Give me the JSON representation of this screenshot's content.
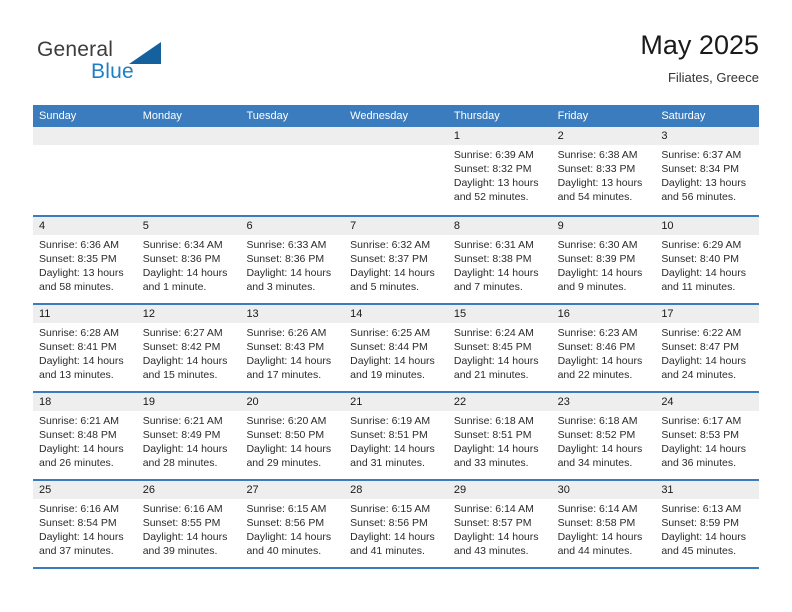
{
  "brand": {
    "name_top": "General",
    "name_bottom": "Blue",
    "triangle_color": "#15619e",
    "blue_color": "#1f7fc4"
  },
  "header": {
    "title": "May 2025",
    "subtitle": "Filiates, Greece"
  },
  "theme": {
    "header_blue": "#3a7cbe",
    "daynum_band": "#eeeeee",
    "text": "#2b2b2b"
  },
  "weekdays": [
    "Sunday",
    "Monday",
    "Tuesday",
    "Wednesday",
    "Thursday",
    "Friday",
    "Saturday"
  ],
  "weeks": [
    [
      {
        "empty": true
      },
      {
        "empty": true
      },
      {
        "empty": true
      },
      {
        "empty": true
      },
      {
        "day": "1",
        "sunrise": "Sunrise: 6:39 AM",
        "sunset": "Sunset: 8:32 PM",
        "daylight": "Daylight: 13 hours and 52 minutes."
      },
      {
        "day": "2",
        "sunrise": "Sunrise: 6:38 AM",
        "sunset": "Sunset: 8:33 PM",
        "daylight": "Daylight: 13 hours and 54 minutes."
      },
      {
        "day": "3",
        "sunrise": "Sunrise: 6:37 AM",
        "sunset": "Sunset: 8:34 PM",
        "daylight": "Daylight: 13 hours and 56 minutes."
      }
    ],
    [
      {
        "day": "4",
        "sunrise": "Sunrise: 6:36 AM",
        "sunset": "Sunset: 8:35 PM",
        "daylight": "Daylight: 13 hours and 58 minutes."
      },
      {
        "day": "5",
        "sunrise": "Sunrise: 6:34 AM",
        "sunset": "Sunset: 8:36 PM",
        "daylight": "Daylight: 14 hours and 1 minute."
      },
      {
        "day": "6",
        "sunrise": "Sunrise: 6:33 AM",
        "sunset": "Sunset: 8:36 PM",
        "daylight": "Daylight: 14 hours and 3 minutes."
      },
      {
        "day": "7",
        "sunrise": "Sunrise: 6:32 AM",
        "sunset": "Sunset: 8:37 PM",
        "daylight": "Daylight: 14 hours and 5 minutes."
      },
      {
        "day": "8",
        "sunrise": "Sunrise: 6:31 AM",
        "sunset": "Sunset: 8:38 PM",
        "daylight": "Daylight: 14 hours and 7 minutes."
      },
      {
        "day": "9",
        "sunrise": "Sunrise: 6:30 AM",
        "sunset": "Sunset: 8:39 PM",
        "daylight": "Daylight: 14 hours and 9 minutes."
      },
      {
        "day": "10",
        "sunrise": "Sunrise: 6:29 AM",
        "sunset": "Sunset: 8:40 PM",
        "daylight": "Daylight: 14 hours and 11 minutes."
      }
    ],
    [
      {
        "day": "11",
        "sunrise": "Sunrise: 6:28 AM",
        "sunset": "Sunset: 8:41 PM",
        "daylight": "Daylight: 14 hours and 13 minutes."
      },
      {
        "day": "12",
        "sunrise": "Sunrise: 6:27 AM",
        "sunset": "Sunset: 8:42 PM",
        "daylight": "Daylight: 14 hours and 15 minutes."
      },
      {
        "day": "13",
        "sunrise": "Sunrise: 6:26 AM",
        "sunset": "Sunset: 8:43 PM",
        "daylight": "Daylight: 14 hours and 17 minutes."
      },
      {
        "day": "14",
        "sunrise": "Sunrise: 6:25 AM",
        "sunset": "Sunset: 8:44 PM",
        "daylight": "Daylight: 14 hours and 19 minutes."
      },
      {
        "day": "15",
        "sunrise": "Sunrise: 6:24 AM",
        "sunset": "Sunset: 8:45 PM",
        "daylight": "Daylight: 14 hours and 21 minutes."
      },
      {
        "day": "16",
        "sunrise": "Sunrise: 6:23 AM",
        "sunset": "Sunset: 8:46 PM",
        "daylight": "Daylight: 14 hours and 22 minutes."
      },
      {
        "day": "17",
        "sunrise": "Sunrise: 6:22 AM",
        "sunset": "Sunset: 8:47 PM",
        "daylight": "Daylight: 14 hours and 24 minutes."
      }
    ],
    [
      {
        "day": "18",
        "sunrise": "Sunrise: 6:21 AM",
        "sunset": "Sunset: 8:48 PM",
        "daylight": "Daylight: 14 hours and 26 minutes."
      },
      {
        "day": "19",
        "sunrise": "Sunrise: 6:21 AM",
        "sunset": "Sunset: 8:49 PM",
        "daylight": "Daylight: 14 hours and 28 minutes."
      },
      {
        "day": "20",
        "sunrise": "Sunrise: 6:20 AM",
        "sunset": "Sunset: 8:50 PM",
        "daylight": "Daylight: 14 hours and 29 minutes."
      },
      {
        "day": "21",
        "sunrise": "Sunrise: 6:19 AM",
        "sunset": "Sunset: 8:51 PM",
        "daylight": "Daylight: 14 hours and 31 minutes."
      },
      {
        "day": "22",
        "sunrise": "Sunrise: 6:18 AM",
        "sunset": "Sunset: 8:51 PM",
        "daylight": "Daylight: 14 hours and 33 minutes."
      },
      {
        "day": "23",
        "sunrise": "Sunrise: 6:18 AM",
        "sunset": "Sunset: 8:52 PM",
        "daylight": "Daylight: 14 hours and 34 minutes."
      },
      {
        "day": "24",
        "sunrise": "Sunrise: 6:17 AM",
        "sunset": "Sunset: 8:53 PM",
        "daylight": "Daylight: 14 hours and 36 minutes."
      }
    ],
    [
      {
        "day": "25",
        "sunrise": "Sunrise: 6:16 AM",
        "sunset": "Sunset: 8:54 PM",
        "daylight": "Daylight: 14 hours and 37 minutes."
      },
      {
        "day": "26",
        "sunrise": "Sunrise: 6:16 AM",
        "sunset": "Sunset: 8:55 PM",
        "daylight": "Daylight: 14 hours and 39 minutes."
      },
      {
        "day": "27",
        "sunrise": "Sunrise: 6:15 AM",
        "sunset": "Sunset: 8:56 PM",
        "daylight": "Daylight: 14 hours and 40 minutes."
      },
      {
        "day": "28",
        "sunrise": "Sunrise: 6:15 AM",
        "sunset": "Sunset: 8:56 PM",
        "daylight": "Daylight: 14 hours and 41 minutes."
      },
      {
        "day": "29",
        "sunrise": "Sunrise: 6:14 AM",
        "sunset": "Sunset: 8:57 PM",
        "daylight": "Daylight: 14 hours and 43 minutes."
      },
      {
        "day": "30",
        "sunrise": "Sunrise: 6:14 AM",
        "sunset": "Sunset: 8:58 PM",
        "daylight": "Daylight: 14 hours and 44 minutes."
      },
      {
        "day": "31",
        "sunrise": "Sunrise: 6:13 AM",
        "sunset": "Sunset: 8:59 PM",
        "daylight": "Daylight: 14 hours and 45 minutes."
      }
    ]
  ]
}
